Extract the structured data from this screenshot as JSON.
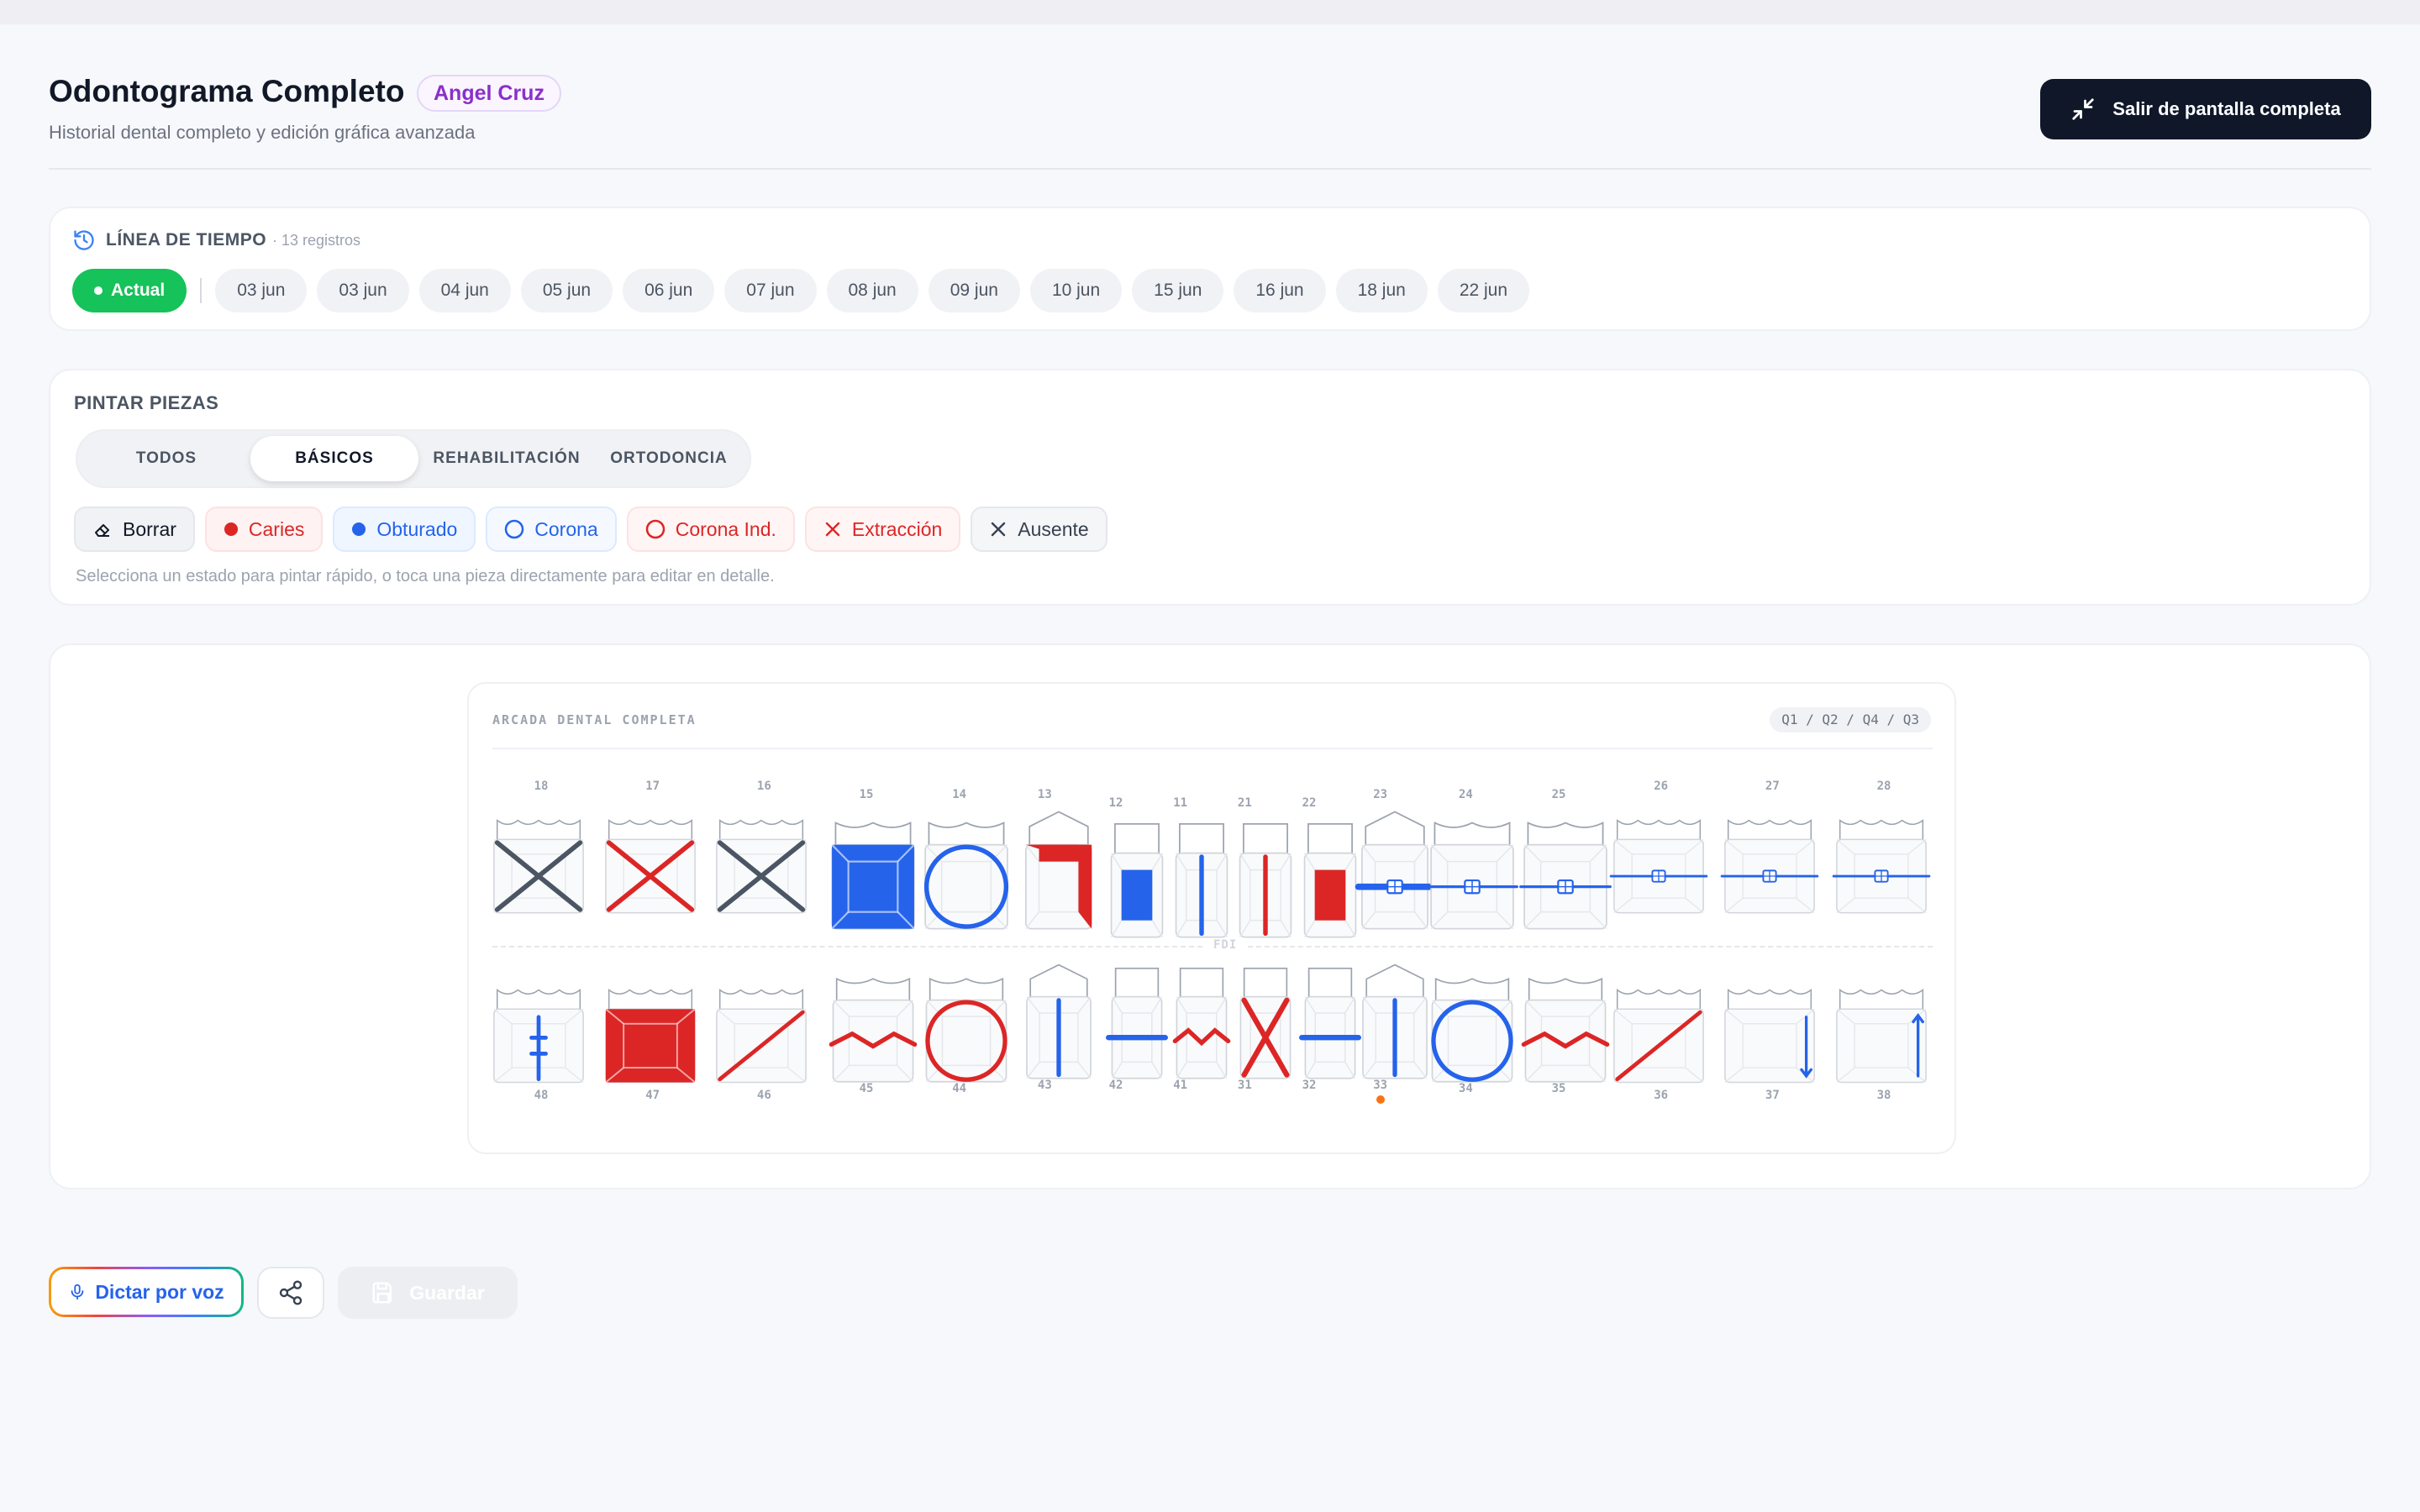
{
  "header": {
    "title": "Odontograma Completo",
    "patient": "Angel Cruz",
    "subtitle": "Historial dental completo y edición gráfica avanzada",
    "fullscreen_label": "Salir de pantalla completa"
  },
  "timeline": {
    "label": "LÍNEA DE TIEMPO",
    "count": "· 13 registros",
    "current": "Actual",
    "dates": [
      "03 jun",
      "03 jun",
      "04 jun",
      "05 jun",
      "06 jun",
      "07 jun",
      "08 jun",
      "09 jun",
      "10 jun",
      "15 jun",
      "16 jun",
      "18 jun",
      "22 jun"
    ]
  },
  "paint": {
    "title": "PINTAR PIEZAS",
    "tabs": [
      {
        "label": "TODOS",
        "active": false
      },
      {
        "label": "BÁSICOS",
        "active": true
      },
      {
        "label": "REHABILITACIÓN",
        "active": false
      },
      {
        "label": "ORTODONCIA",
        "active": false
      }
    ],
    "tools": [
      {
        "label": "Borrar",
        "icon": "eraser-icon",
        "color": "#111827",
        "bg": "#f1f2f5",
        "border": "#e5e7eb"
      },
      {
        "label": "Caries",
        "icon": "dot-icon",
        "color": "#dc2626",
        "bg": "#fef2f2",
        "border": "#fde2e2"
      },
      {
        "label": "Obturado",
        "icon": "dot-icon",
        "color": "#2563eb",
        "bg": "#eff6ff",
        "border": "#dbeafe"
      },
      {
        "label": "Corona",
        "icon": "ring-icon",
        "color": "#2563eb",
        "bg": "#f5f9ff",
        "border": "#dbeafe"
      },
      {
        "label": "Corona Ind.",
        "icon": "ring-icon",
        "color": "#dc2626",
        "bg": "#fff5f5",
        "border": "#fde2e2"
      },
      {
        "label": "Extracción",
        "icon": "x-icon",
        "color": "#dc2626",
        "bg": "#fff5f5",
        "border": "#fde2e2"
      },
      {
        "label": "Ausente",
        "icon": "x-icon",
        "color": "#374151",
        "bg": "#f5f6f8",
        "border": "#e5e7eb"
      }
    ],
    "hint": "Selecciona un estado para pintar rápido, o toca una pieza directamente para editar en detalle."
  },
  "arch": {
    "title": "ARCADA DENTAL COMPLETA",
    "quadrants": "Q1 / Q2 / Q4 / Q3",
    "divider": "FDI",
    "colors": {
      "red": "#dc2626",
      "blue": "#2563eb",
      "gray": "#4b5563",
      "orange": "#f97316"
    },
    "upper": [
      {
        "num": "18",
        "type": "molar",
        "state": "absent"
      },
      {
        "num": "17",
        "type": "molar",
        "state": "extraction"
      },
      {
        "num": "16",
        "type": "molar",
        "state": "absent"
      },
      {
        "num": "15",
        "type": "premolar",
        "state": "filled-full"
      },
      {
        "num": "14",
        "type": "premolar",
        "state": "crown-blue"
      },
      {
        "num": "13",
        "type": "canine",
        "state": "caries-partial"
      },
      {
        "num": "12",
        "type": "incisor",
        "state": "filled-center"
      },
      {
        "num": "11",
        "type": "incisor",
        "state": "line-blue"
      },
      {
        "num": "21",
        "type": "incisor",
        "state": "line-red"
      },
      {
        "num": "22",
        "type": "incisor",
        "state": "caries-center"
      },
      {
        "num": "23",
        "type": "canine",
        "state": "bracket-thick"
      },
      {
        "num": "24",
        "type": "premolar",
        "state": "bracket"
      },
      {
        "num": "25",
        "type": "premolar",
        "state": "bracket"
      },
      {
        "num": "26",
        "type": "molar",
        "state": "bracket"
      },
      {
        "num": "27",
        "type": "molar",
        "state": "bracket"
      },
      {
        "num": "28",
        "type": "molar",
        "state": "bracket"
      }
    ],
    "lower": [
      {
        "num": "48",
        "type": "molar",
        "state": "post"
      },
      {
        "num": "47",
        "type": "molar",
        "state": "caries-full"
      },
      {
        "num": "46",
        "type": "molar",
        "state": "diagonal-red"
      },
      {
        "num": "45",
        "type": "premolar",
        "state": "zigzag"
      },
      {
        "num": "44",
        "type": "premolar",
        "state": "crown-red"
      },
      {
        "num": "43",
        "type": "canine",
        "state": "line-blue"
      },
      {
        "num": "42",
        "type": "incisor",
        "state": "hline-blue"
      },
      {
        "num": "41",
        "type": "incisor",
        "state": "zigzag"
      },
      {
        "num": "31",
        "type": "incisor",
        "state": "extraction"
      },
      {
        "num": "32",
        "type": "incisor",
        "state": "hline-blue"
      },
      {
        "num": "33",
        "type": "canine",
        "state": "line-blue",
        "marker": true
      },
      {
        "num": "34",
        "type": "premolar",
        "state": "crown-blue"
      },
      {
        "num": "35",
        "type": "premolar",
        "state": "zigzag"
      },
      {
        "num": "36",
        "type": "molar",
        "state": "diagonal-red"
      },
      {
        "num": "37",
        "type": "molar",
        "state": "arrow-down"
      },
      {
        "num": "38",
        "type": "molar",
        "state": "arrow-up"
      }
    ]
  },
  "actions": {
    "voice": "Dictar por voz",
    "save": "Guardar"
  }
}
